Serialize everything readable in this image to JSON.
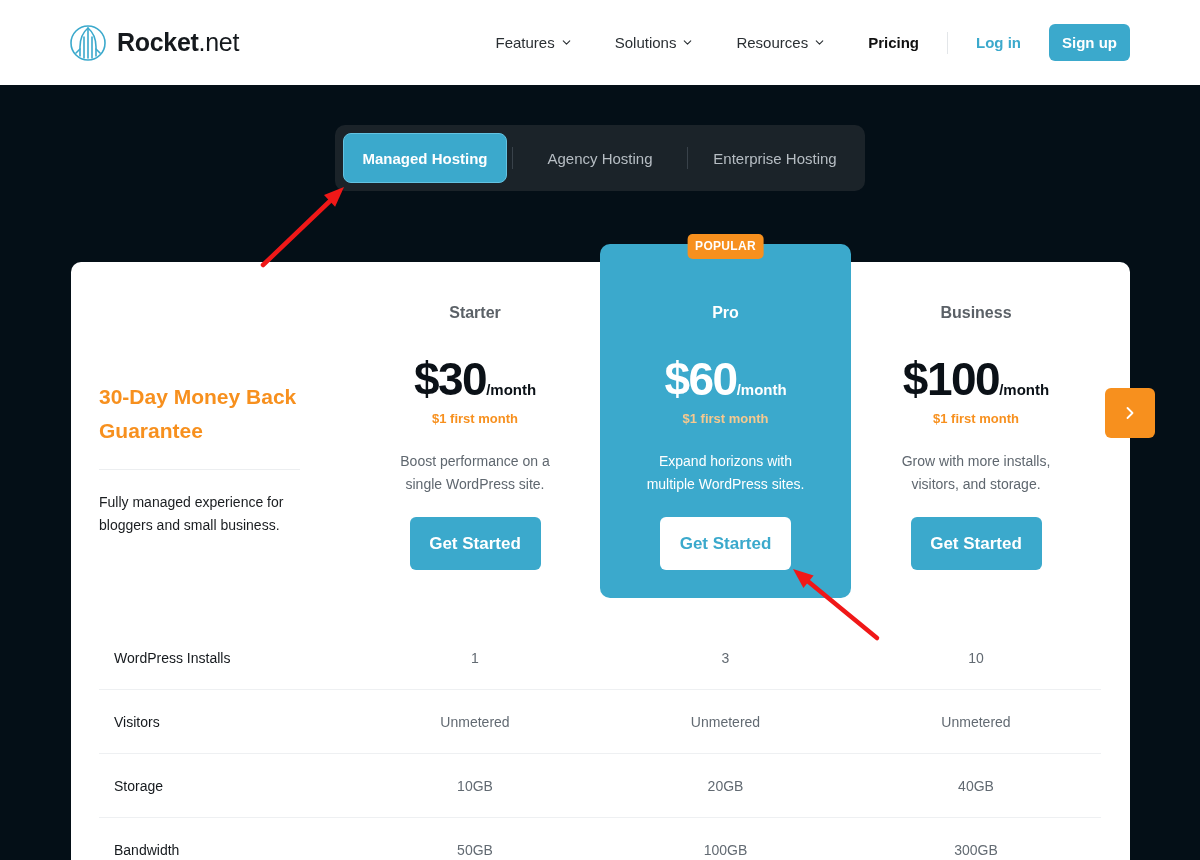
{
  "header": {
    "logo": "**Rocket**.net",
    "nav": [
      {
        "label": "Features",
        "kind": "dropdown"
      },
      {
        "label": "Solutions",
        "kind": "dropdown"
      },
      {
        "label": "Resources",
        "kind": "dropdown"
      },
      {
        "label": "Pricing",
        "kind": "link"
      }
    ],
    "login": "Log in",
    "signup": "Sign up"
  },
  "hosting_tabs": [
    {
      "label": "Managed Hosting",
      "selected": true
    },
    {
      "label": "Agency Hosting",
      "selected": false
    },
    {
      "label": "Enterprise Hosting",
      "selected": false
    }
  ],
  "guarantee": {
    "title": "30-Day Money Back Guarantee",
    "description": "Fully managed experience for bloggers and small business."
  },
  "plans": [
    {
      "name": "Starter",
      "price": "$30",
      "period": "/month",
      "promo": "$1 first month",
      "description": "Boost performance on a single WordPress site.",
      "button": "Get Started",
      "featured": false
    },
    {
      "name": "Pro",
      "badge": "POPULAR",
      "price": "$60",
      "period": "/month",
      "promo": "$1 first month",
      "description": "Expand horizons with multiple WordPress sites.",
      "button": "Get Started",
      "featured": true
    },
    {
      "name": "Business",
      "price": "$100",
      "period": "/month",
      "promo": "$1 first month",
      "description": "Grow with more installs, visitors, and storage.",
      "button": "Get Started",
      "featured": false
    }
  ],
  "features": [
    {
      "label": "WordPress Installs",
      "values": [
        "1",
        "3",
        "10"
      ]
    },
    {
      "label": "Visitors",
      "values": [
        "Unmetered",
        "Unmetered",
        "Unmetered"
      ]
    },
    {
      "label": "Storage",
      "values": [
        "10GB",
        "20GB",
        "40GB"
      ]
    },
    {
      "label": "Bandwidth",
      "values": [
        "50GB",
        "100GB",
        "300GB"
      ]
    }
  ]
}
